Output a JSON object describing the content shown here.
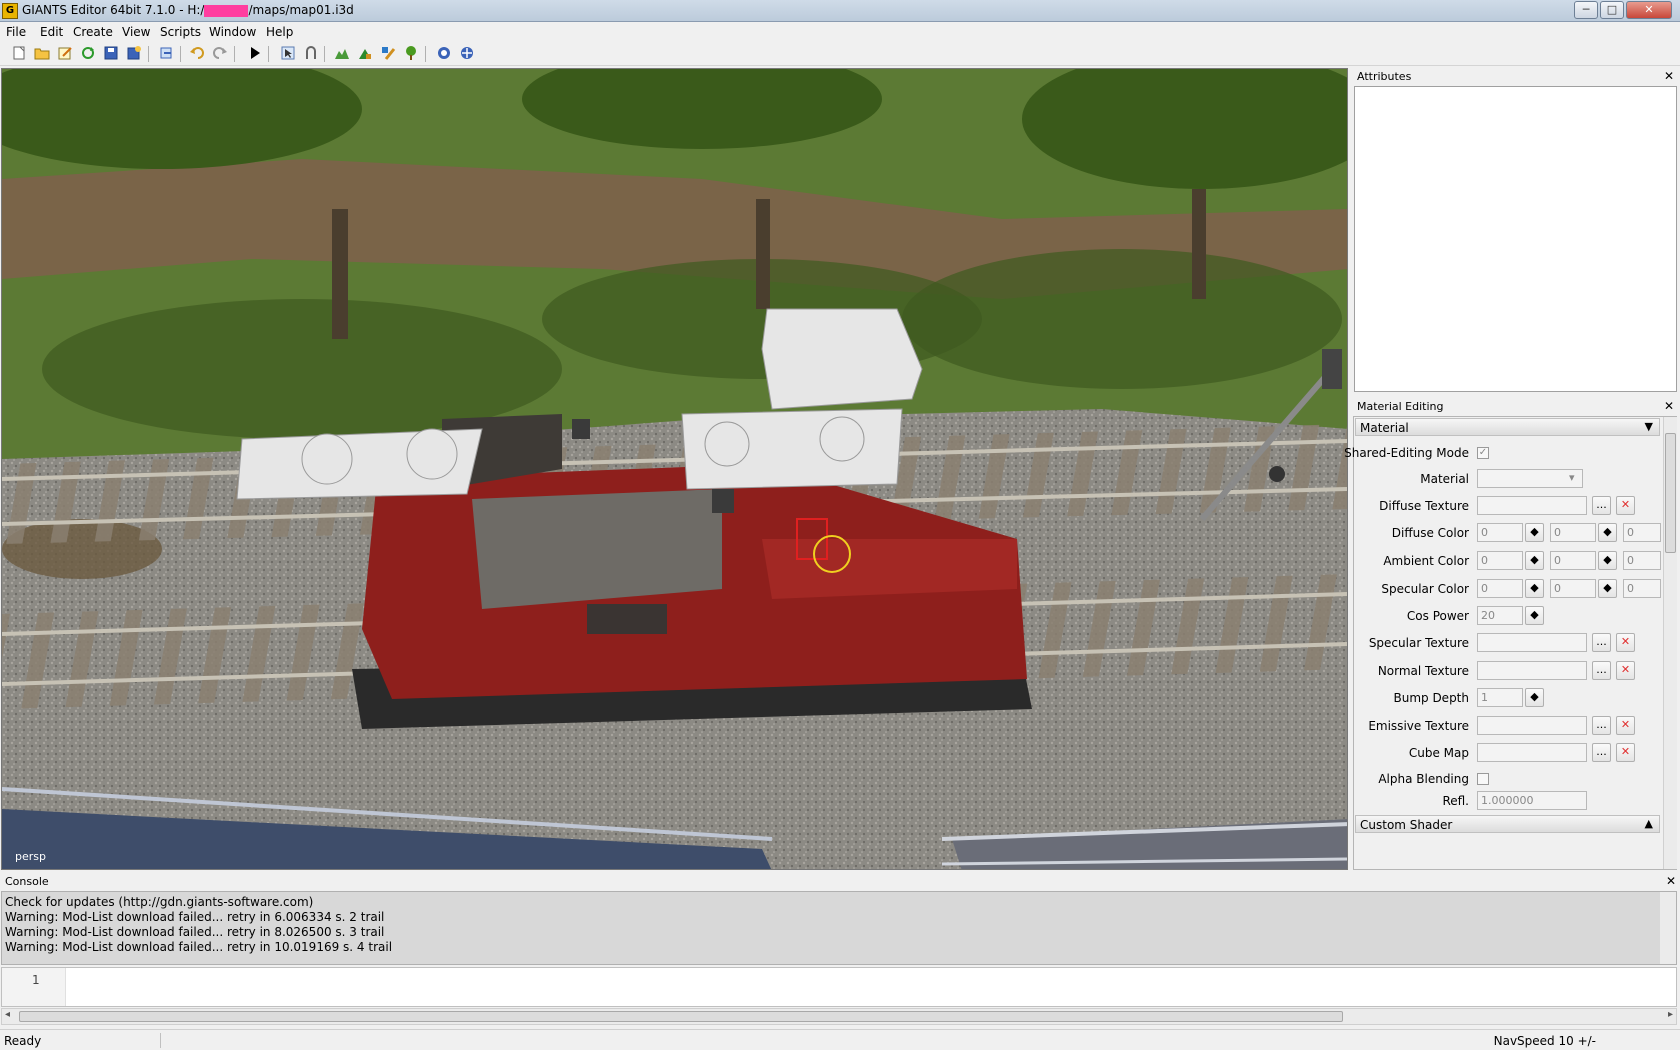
{
  "window": {
    "title_prefix": "GIANTS Editor 64bit 7.1.0 - H:/",
    "title_suffix": "/maps/map01.i3d",
    "app_icon_glyph": "G",
    "minimize_glyph": "─",
    "maximize_glyph": "□",
    "close_glyph": "✕"
  },
  "menu": [
    "File",
    "Edit",
    "Create",
    "View",
    "Scripts",
    "Window",
    "Help"
  ],
  "toolbar": {
    "icons": [
      "new-file-icon",
      "open-file-icon",
      "edit-icon",
      "refresh-icon",
      "save-icon",
      "save-as-icon",
      "export-icon",
      "undo-icon",
      "redo-icon",
      "play-icon",
      "select-mode-icon",
      "translate-mode-icon",
      "terrain-paint-icon",
      "foliage-paint-icon",
      "texture-paint-icon",
      "tree-paint-icon",
      "settings-cycle-icon",
      "network-icon"
    ]
  },
  "viewport": {
    "camera_label": "persp"
  },
  "attributes_panel": {
    "title": "Attributes",
    "close_glyph": "✕"
  },
  "material_panel": {
    "title": "Material Editing",
    "close_glyph": "✕",
    "section_material": "Material",
    "section_material_arrow": "▼",
    "section_custom_shader": "Custom Shader",
    "section_custom_shader_arrow": "▲",
    "browse_glyph": "...",
    "clear_glyph": "✕",
    "stepper_glyph": "◆",
    "checkmark_glyph": "✓",
    "dropdown_glyph": "▾",
    "rows": {
      "shared_editing_mode": {
        "label": "Shared-Editing Mode",
        "checked": true
      },
      "material": {
        "label": "Material",
        "value": ""
      },
      "diffuse_texture": {
        "label": "Diffuse Texture",
        "value": ""
      },
      "diffuse_color": {
        "label": "Diffuse Color",
        "r": "0",
        "g": "0",
        "b": "0"
      },
      "ambient_color": {
        "label": "Ambient Color",
        "r": "0",
        "g": "0",
        "b": "0"
      },
      "specular_color": {
        "label": "Specular Color",
        "r": "0",
        "g": "0",
        "b": "0"
      },
      "cos_power": {
        "label": "Cos Power",
        "value": "20"
      },
      "specular_texture": {
        "label": "Specular Texture",
        "value": ""
      },
      "normal_texture": {
        "label": "Normal Texture",
        "value": ""
      },
      "bump_depth": {
        "label": "Bump Depth",
        "value": "1"
      },
      "emissive_texture": {
        "label": "Emissive Texture",
        "value": ""
      },
      "cube_map": {
        "label": "Cube Map",
        "value": ""
      },
      "alpha_blending": {
        "label": "Alpha Blending",
        "checked": false
      },
      "refl": {
        "label": "Refl.",
        "value": "1.000000"
      }
    }
  },
  "console": {
    "title": "Console",
    "close_glyph": "✕",
    "lines": [
      "Check for updates (http://gdn.giants-software.com)",
      "Warning: Mod-List download failed... retry in 6.006334 s. 2 trail",
      "Warning: Mod-List download failed... retry in 8.026500 s. 3 trail",
      "Warning: Mod-List download failed... retry in 10.019169 s. 4 trail"
    ],
    "input_line_number": "1",
    "scroll_left_glyph": "◂",
    "scroll_right_glyph": "▸"
  },
  "status": {
    "text": "Ready",
    "navspeed": "NavSpeed 10 +/-"
  }
}
